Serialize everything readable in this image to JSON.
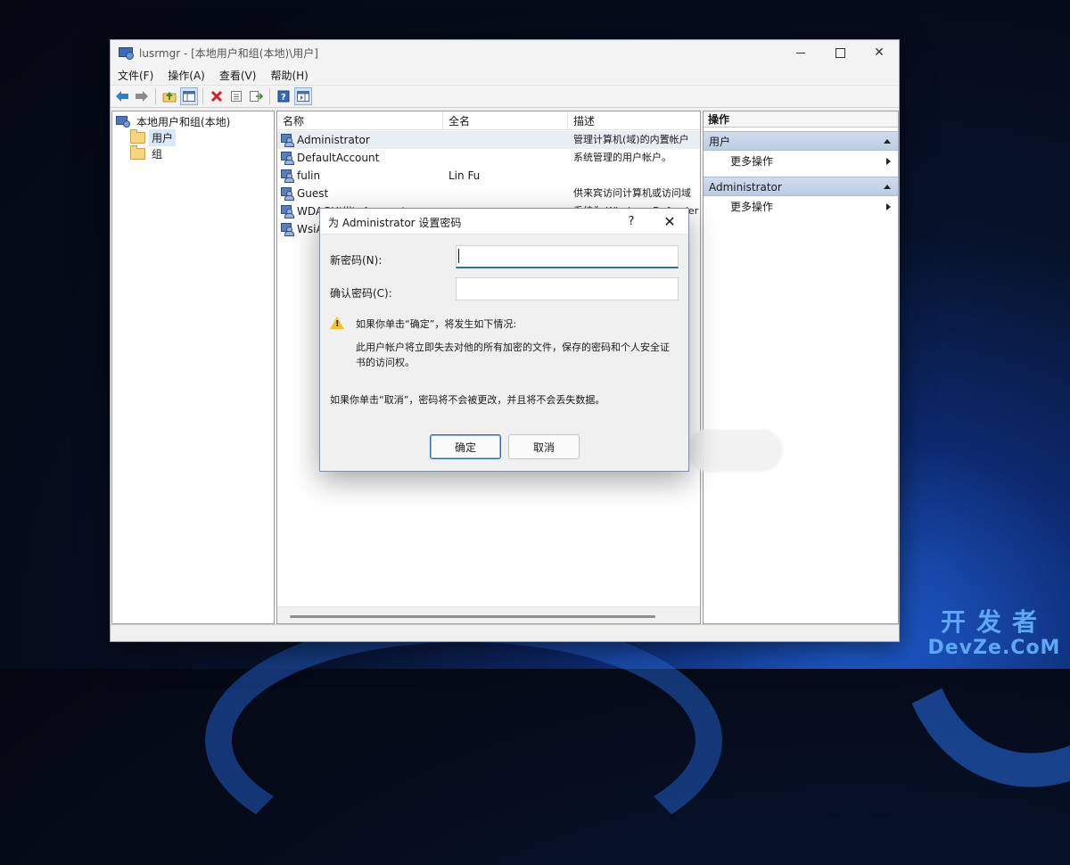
{
  "window": {
    "title": "lusrmgr - [本地用户和组(本地)\\用户]"
  },
  "menu": [
    "文件(F)",
    "操作(A)",
    "查看(V)",
    "帮助(H)"
  ],
  "tree": {
    "root": "本地用户和组(本地)",
    "children": [
      "用户",
      "组"
    ]
  },
  "list": {
    "columns": [
      "名称",
      "全名",
      "描述"
    ],
    "rows": [
      {
        "name": "Administrator",
        "fullname": "",
        "desc": "管理计算机(域)的内置帐户"
      },
      {
        "name": "DefaultAccount",
        "fullname": "",
        "desc": "系统管理的用户帐户。"
      },
      {
        "name": "fulin",
        "fullname": "Lin Fu",
        "desc": ""
      },
      {
        "name": "Guest",
        "fullname": "",
        "desc": "供来宾访问计算机或访问域"
      },
      {
        "name": "WDAGUtilityAccount",
        "fullname": "",
        "desc": "系统为 Windows Defender"
      },
      {
        "name": "WsiAccount",
        "fullname": "",
        "desc": ""
      }
    ]
  },
  "actions": {
    "title": "操作",
    "sections": [
      {
        "label": "用户",
        "item": "更多操作"
      },
      {
        "label": "Administrator",
        "item": "更多操作"
      }
    ]
  },
  "dialog": {
    "title": "为 Administrator 设置密码",
    "help": "?",
    "new_password_label": "新密码(N):",
    "confirm_password_label": "确认密码(C):",
    "new_password_value": "",
    "confirm_password_value": "",
    "warning_heading": "如果你单击“确定”，将发生如下情况:",
    "warning_body": "此用户帐户将立即失去对他的所有加密的文件，保存的密码和个人安全证书的访问权。",
    "cancel_note": "如果你单击“取消”，密码将不会被更改，并且将不会丢失数据。",
    "ok_label": "确定",
    "cancel_label": "取消"
  },
  "watermark": {
    "line1": "开发者",
    "line2": "DevZe.CoM"
  }
}
